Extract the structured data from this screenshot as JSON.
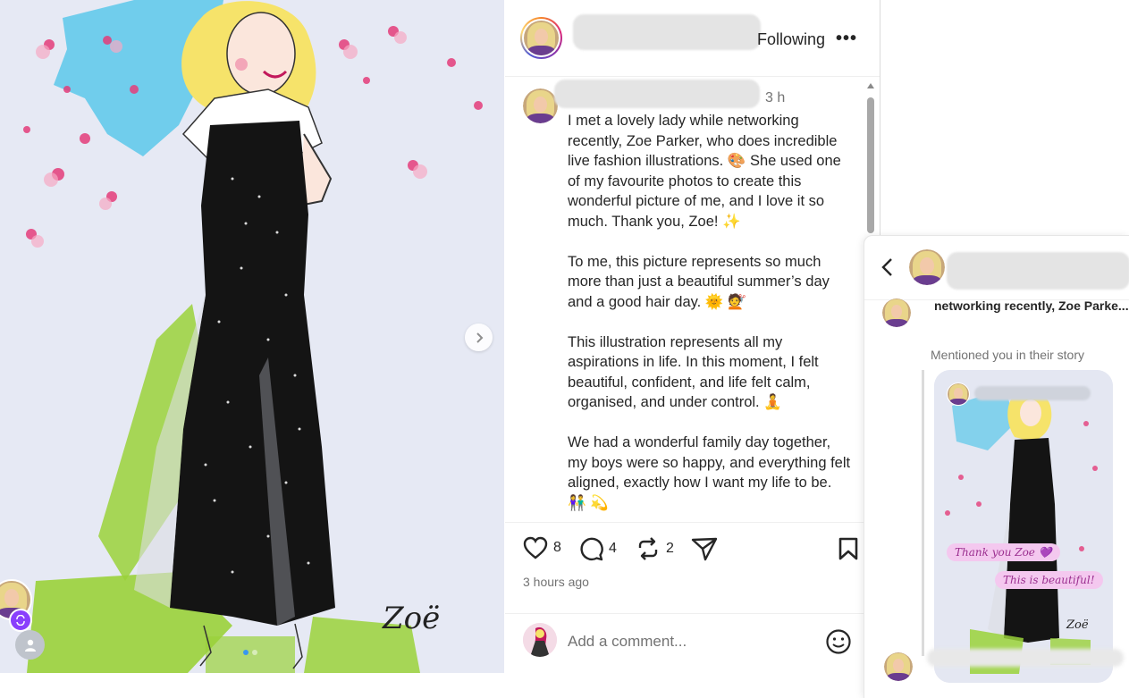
{
  "post": {
    "following_label": "Following",
    "more_label": "•••",
    "caption_time": "3 h",
    "caption_paragraphs": [
      "I met a lovely lady while networking recently, Zoe Parker, who does incredible live fashion illustrations. 🎨 She used one of my favourite photos to create this wonderful picture of me, and I love it so much. Thank you, Zoe! ✨",
      "To me, this picture represents so much more than just a beautiful summer’s day and a good hair day. 🌞 💇",
      "This illustration represents all my aspirations in life. In this moment, I felt beautiful, confident, and life felt calm, organised, and under control. 🧘",
      "We had a wonderful family day together, my boys were so happy, and everything felt aligned, exactly how I want my life to be. 👫 💫"
    ],
    "likes": "8",
    "comments": "4",
    "reposts": "2",
    "time_ago": "3 hours ago",
    "comment_placeholder": "Add a comment..."
  },
  "image": {
    "signature": "Zoë",
    "carousel_total": 2,
    "carousel_active": 1
  },
  "dm": {
    "message_preview": "networking recently, Zoe Parke...",
    "mentioned_label": "Mentioned you in their story",
    "story_stickers": [
      "Thank you Zoe 💜",
      "This is beautiful!"
    ],
    "story_signature": "Zoë"
  },
  "colors": {
    "accent": "#3897f0",
    "text_primary": "#262626",
    "text_secondary": "#737373",
    "repost_badge": "#8a3ffc"
  },
  "icons": {
    "like": "heart-icon",
    "comment": "comment-icon",
    "repost": "repost-icon",
    "share": "share-icon",
    "save": "bookmark-icon",
    "emoji": "emoji-icon",
    "back": "chevron-left-icon",
    "next": "chevron-right-icon"
  }
}
